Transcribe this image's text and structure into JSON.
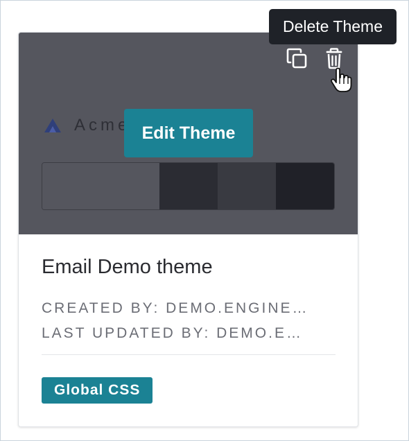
{
  "card": {
    "preview": {
      "logo_text": "Acme",
      "logo_icon": "acme-logo-triangle",
      "swatch_colors": [
        "#55565e",
        "#2b2c33",
        "#393a41",
        "#202128"
      ],
      "edit_button_label": "Edit Theme"
    },
    "actions": {
      "copy_icon": "duplicate-icon",
      "delete_icon": "trash-icon"
    },
    "title": "Email Demo theme",
    "created_by": "CREATED BY: DEMO.ENGINE…",
    "last_updated_by": "LAST UPDATED BY: DEMO.E…",
    "badge": "Global CSS"
  },
  "tooltip": {
    "text": "Delete Theme"
  },
  "colors": {
    "accent": "#1b8294",
    "preview_overlay": "#55565e",
    "tooltip_bg": "#1f2228"
  }
}
